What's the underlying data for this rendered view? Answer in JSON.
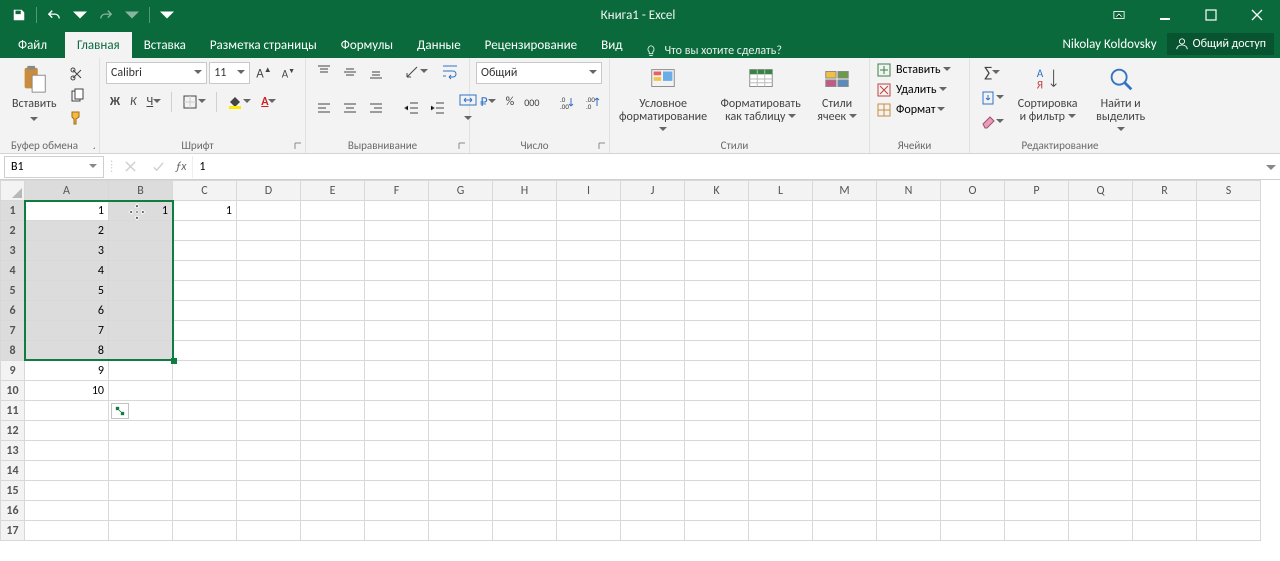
{
  "title": "Книга1 - Excel",
  "user": "Nikolay Koldovsky",
  "share": "Общий доступ",
  "tabs": [
    "Файл",
    "Главная",
    "Вставка",
    "Разметка страницы",
    "Формулы",
    "Данные",
    "Рецензирование",
    "Вид"
  ],
  "activeTabIndex": 1,
  "tellMe": "Что вы хотите сделать?",
  "nameBox": "B1",
  "formula": "1",
  "groups": {
    "clipboard": {
      "label": "Буфер обмена",
      "paste": "Вставить"
    },
    "font": {
      "label": "Шрифт",
      "family": "Calibri",
      "size": "11",
      "bold": "Ж",
      "italic": "К",
      "under": "Ч"
    },
    "alignment": {
      "label": "Выравнивание"
    },
    "number": {
      "label": "Число",
      "format": "Общий"
    },
    "styles": {
      "label": "Стили",
      "cond": "Условное форматирование",
      "table": "Форматировать как таблицу",
      "cell": "Стили ячеек"
    },
    "cells": {
      "label": "Ячейки",
      "insert": "Вставить",
      "delete": "Удалить",
      "format": "Формат"
    },
    "editing": {
      "label": "Редактирование",
      "sort": "Сортировка и фильтр",
      "find": "Найти и выделить"
    }
  },
  "columns": [
    "A",
    "B",
    "C",
    "D",
    "E",
    "F",
    "G",
    "H",
    "I",
    "J",
    "K",
    "L",
    "M",
    "N",
    "O",
    "P",
    "Q",
    "R",
    "S"
  ],
  "rows": [
    1,
    2,
    3,
    4,
    5,
    6,
    7,
    8,
    9,
    10,
    11,
    12,
    13,
    14,
    15,
    16,
    17
  ],
  "cells": {
    "A1": "1",
    "A2": "2",
    "A3": "3",
    "A4": "4",
    "A5": "5",
    "A6": "6",
    "A7": "7",
    "A8": "8",
    "A9": "9",
    "A10": "10",
    "B1": "1",
    "C1": "1"
  },
  "selection": {
    "startCol": "A",
    "startRow": 1,
    "endCol": "B",
    "endRow": 8
  },
  "selColumns": [
    "A",
    "B"
  ],
  "selRows": [
    1,
    2,
    3,
    4,
    5,
    6,
    7,
    8
  ],
  "activeCell": "A1",
  "colWidths": {
    "default": 64,
    "A": 84
  },
  "chart_data": null
}
